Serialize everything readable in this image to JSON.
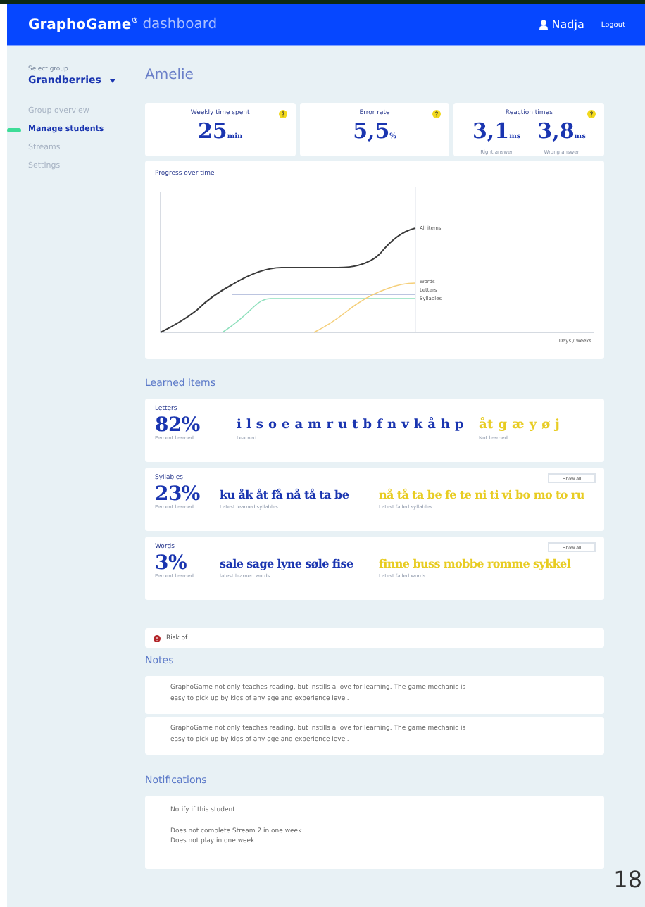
{
  "header": {
    "brand": "GraphoGame",
    "brand_mark": "®",
    "subtitle": "dashboard",
    "user": "Nadja",
    "logout": "Logout"
  },
  "sidebar": {
    "group_label": "Select group",
    "group": "Grandberries",
    "items": [
      {
        "label": "Group overview",
        "selected": false
      },
      {
        "label": "Manage students",
        "selected": true
      },
      {
        "label": "Streams",
        "selected": false
      },
      {
        "label": "Settings",
        "selected": false
      }
    ]
  },
  "student": "Amelie",
  "stats": [
    {
      "title": "Weekly time spent",
      "values": [
        {
          "value": "25",
          "unit": "min"
        }
      ]
    },
    {
      "title": "Error rate",
      "values": [
        {
          "value": "5,5",
          "unit": "%"
        }
      ]
    },
    {
      "title": "Reaction times",
      "values": [
        {
          "value": "3,1",
          "unit": "ms",
          "caption": "Right answer"
        },
        {
          "value": "3,8",
          "unit": "ms",
          "caption": "Wrong answer"
        }
      ]
    }
  ],
  "progress": {
    "title": "Progress over time",
    "series_labels": [
      "All items",
      "Words",
      "Letters",
      "Syllables"
    ],
    "xlabel": "Days / weeks"
  },
  "learned_heading": "Learned items",
  "learned": [
    {
      "title": "Letters",
      "percent": "82%",
      "percent_caption": "Percent learned",
      "learned": "i l s o e a m r u t b f n v k å h p",
      "learned_caption": "Learned",
      "failed": "åt g æ y ø j",
      "failed_caption": "Not learned"
    },
    {
      "title": "Syllables",
      "button": "Show all",
      "percent": "23%",
      "percent_caption": "Percent learned",
      "learned": "ku åk åt få nå tå ta be",
      "learned_caption": "Latest learned syllables",
      "failed": "nå tå ta be fe te ni ti vi bo mo to ru",
      "failed_caption": "Latest failed syllables"
    },
    {
      "title": "Words",
      "button": "Show all",
      "percent": "3%",
      "percent_caption": "Percent learned",
      "learned": "sale sage lyne søle fise",
      "learned_caption": "latest learned words",
      "failed": "finne buss mobbe romme sykkel",
      "failed_caption": "Latest failed words"
    }
  ],
  "risk": "Risk of ...",
  "notes_heading": "Notes",
  "notes": [
    "GraphoGame not only teaches reading, but instills a love for learning. The game mechanic is easy to pick up by kids of any age and experience level.",
    "GraphoGame not only teaches reading, but instills a love for learning. The game mechanic is easy to pick up by kids of any age and experience level."
  ],
  "notifications_heading": "Notifications",
  "notifications": {
    "intro": "Notify if this student...",
    "rules": [
      "Does not complete Stream 2 in one week",
      "Does not play in one week"
    ]
  },
  "page_number": "18"
}
